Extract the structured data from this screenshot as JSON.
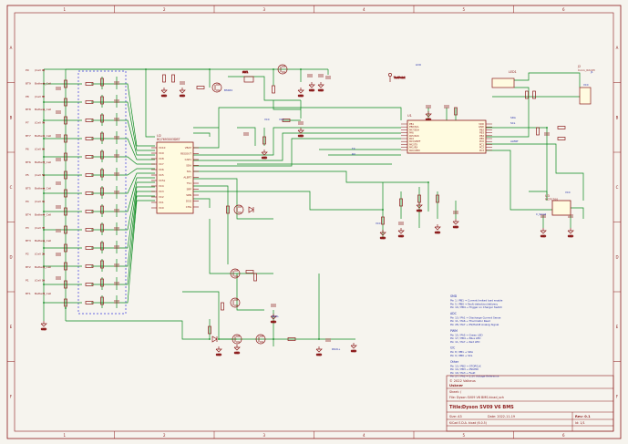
{
  "colors": {
    "paper": "#f6f4ee",
    "frame": "#8b1a1a",
    "wire": "#0a8a1e",
    "component": "#8b1a1a",
    "label": "#1f2aa8",
    "dashed_box": "#3a3adf"
  },
  "frame": {
    "cols": [
      "1",
      "2",
      "3",
      "4",
      "5",
      "6"
    ],
    "rows": [
      "A",
      "B",
      "C",
      "D",
      "E",
      "F"
    ]
  },
  "icons": {
    "ground": "ground-icon",
    "resistor": "resistor-icon",
    "capacitor": "capacitor-icon",
    "mosfet": "mosfet-icon",
    "diode": "diode-icon"
  },
  "connectors": [
    {
      "pin": "P9",
      "cell": "(Cell 9)"
    },
    {
      "pin": "BT9",
      "cell": "Battery_Cell"
    },
    {
      "pin": "P8",
      "cell": "(Cell 8)"
    },
    {
      "pin": "BT8",
      "cell": "Battery_Cell"
    },
    {
      "pin": "P7",
      "cell": "(Cell 7)"
    },
    {
      "pin": "BT7",
      "cell": "Battery_Cell"
    },
    {
      "pin": "P6",
      "cell": "(Cell 6)"
    },
    {
      "pin": "BT6",
      "cell": "Battery_Cell"
    },
    {
      "pin": "P5",
      "cell": "(Cell 5)"
    },
    {
      "pin": "BT5",
      "cell": "Battery_Cell"
    },
    {
      "pin": "P4",
      "cell": "(Cell 4)"
    },
    {
      "pin": "BT4",
      "cell": "Battery_Cell"
    },
    {
      "pin": "P3",
      "cell": "(Cell 3)"
    },
    {
      "pin": "BT3",
      "cell": "Battery_Cell"
    },
    {
      "pin": "P2",
      "cell": "(Cell 2)"
    },
    {
      "pin": "BT2",
      "cell": "Battery_Cell"
    },
    {
      "pin": "P1",
      "cell": "(Cell 1)"
    },
    {
      "pin": "BT1",
      "cell": "Battery_Cell"
    }
  ],
  "labels": {
    "gnd": "GND",
    "vcc": "VCC",
    "u2_ref": "U2",
    "u2_part": "BQ7693003DBT",
    "u1_ref": "U1",
    "u3_ref": "U3",
    "mcp_part": "MCP1700",
    "q_part": "BSS84",
    "led_ref": "LED1",
    "sw_ref": "SW1",
    "test_point": "TestPoint",
    "c_small": "C_Small",
    "r_small": "R_Small",
    "conn_ref": "J1",
    "conn_part": "Conn_01x03",
    "prog_ref": "J2",
    "prog_part": "Conn_02x03",
    "pack_plus": "PACK+",
    "pack_minus": "PACK-",
    "ldo": "LDO",
    "sda": "SDA",
    "scl": "SCL",
    "alert": "ALERT",
    "tx": "TX",
    "rx": "RX",
    "vbat": "VBAT",
    "sensebat": "SRN",
    "srp": "SRP",
    "ts1": "TS1",
    "dsg": "DSG",
    "chg": "CHG",
    "regout": "REGOUT",
    "cap1": "CAP1",
    "vc": [
      "VC10",
      "VC9",
      "VC8",
      "VC7",
      "VC6",
      "VC5",
      "VC5x",
      "VC4",
      "VC3",
      "VC2",
      "VC1",
      "VC0"
    ],
    "mcu_pins_left": [
      "PB1",
      "PB0/SCL",
      "PA7/SDA",
      "PA6",
      "PA5/SCK",
      "PA4",
      "PA3/VREF",
      "PA2/TX",
      "PA1/RX",
      "PA0/UPDI"
    ],
    "mcu_pins_right": [
      "VDD",
      "GND",
      "PB2",
      "PB3",
      "PB4",
      "PB5",
      "PC0",
      "PC1",
      "PC2",
      "PC3"
    ]
  },
  "notes": {
    "sections": [
      {
        "title": "SMD",
        "lines": [
          "Pin 1 / PB1 → Current limited load enable",
          "Pin 5 / PB0 → Fault detection/delivery",
          "Pin 10 / PB4 → Trigger on Charger Switch"
        ]
      },
      {
        "title": "ADC",
        "lines": [
          "Pin 13 / PA1 → Discharge Current Sense",
          "Pin 11 / PA6 → Thermistor Read",
          "Pin 28 / PA7 → PS/Hall-B Analog Signal"
        ]
      },
      {
        "title": "PWM",
        "lines": [
          "Pin 15 / PA5 → Green LED",
          "Pin 17 / PB4 → Blue LED",
          "Pin 11 / PA7 → Red LED"
        ]
      },
      {
        "title": "I2C",
        "lines": [
          "Pin 8 / PB1 → SDA",
          "Pin 9 / PB0 → SCL"
        ]
      },
      {
        "title": "Other",
        "lines": [
          "Pin 13 / PB2 → STOPCLK",
          "Pin 14 / PB3 → PSUPDI",
          "Pin 19 / PA3 → Fault",
          "Pin 27 / PA2 → 2.5V Voltage Reference"
        ]
      }
    ]
  },
  "title_block": {
    "copyright": "© 2022 Valkeus",
    "company": "Uskner",
    "sheet": "Sheet: /",
    "file": "File: Dyson SV09 V6 BMS.kicad_sch",
    "title_prefix": "Title:",
    "title": "Dyson SV09 V6 BMS",
    "size_label": "Size: A3",
    "date": "Date: 2022-11-19",
    "rev_label": "Rev: 0.1",
    "kicad": "KiCad E.D.A. kicad (6.0.5)",
    "id": "Id: 1/1"
  }
}
